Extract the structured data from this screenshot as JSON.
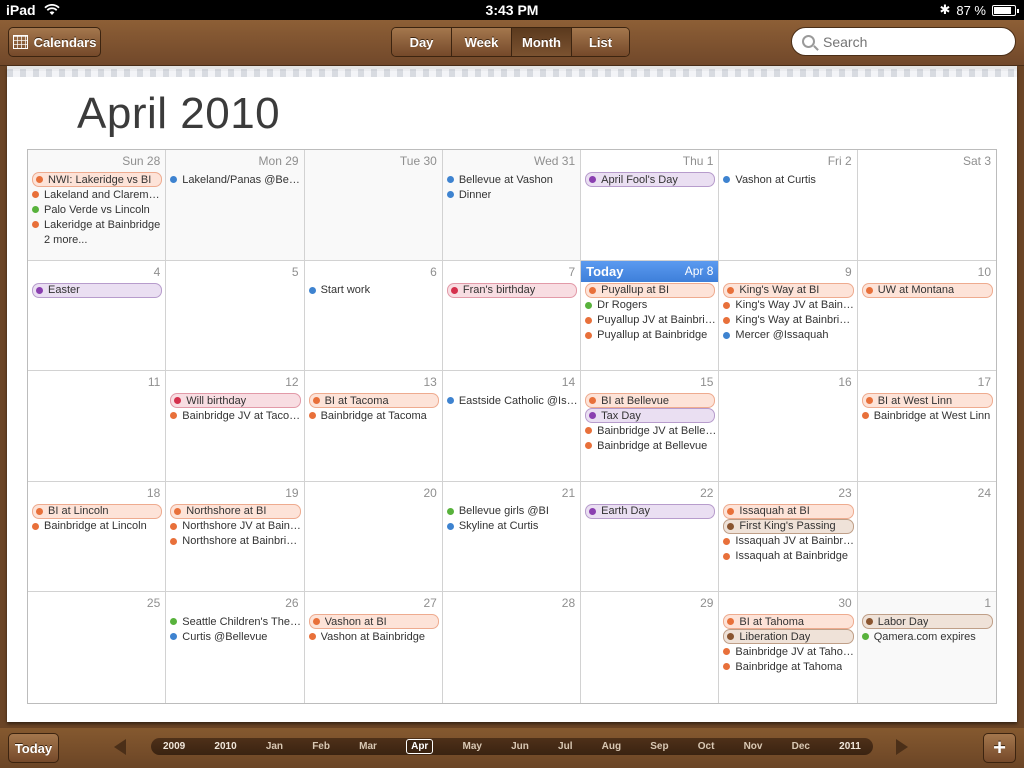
{
  "status": {
    "device": "iPad",
    "time": "3:43 PM",
    "battery": "87 %",
    "battery_fraction": 0.87
  },
  "toolbar": {
    "calendars_label": "Calendars",
    "views": [
      {
        "label": "Day",
        "active": false
      },
      {
        "label": "Week",
        "active": false
      },
      {
        "label": "Month",
        "active": true
      },
      {
        "label": "List",
        "active": false
      }
    ],
    "search_placeholder": "Search"
  },
  "month_title": "April 2010",
  "colors": {
    "orange": "#e8703a",
    "blue": "#3e83d0",
    "green": "#58b23c",
    "red": "#d4304c",
    "purple": "#8a3fb0",
    "brown": "#8a5530"
  },
  "allday_styles": {
    "orange": {
      "bg": "#fde3d8",
      "border": "#eeab8f"
    },
    "purple": {
      "bg": "#eadff2",
      "border": "#b79ccc"
    },
    "red": {
      "bg": "#f8dde2",
      "border": "#e29aa8"
    },
    "brown": {
      "bg": "#efe2d8",
      "border": "#bf9f88"
    }
  },
  "today": {
    "word": "Today",
    "date": "Apr 8"
  },
  "days": [
    {
      "label": "Sun 28",
      "out": true,
      "events": [
        {
          "t": "NWI: Lakeridge vs BI",
          "c": "orange",
          "allday": true
        },
        {
          "t": "Lakeland and Claremont",
          "c": "orange"
        },
        {
          "t": "Palo Verde vs Lincoln",
          "c": "green"
        },
        {
          "t": "Lakeridge at Bainbridge",
          "c": "orange"
        },
        {
          "t": "2 more...",
          "more": true
        }
      ]
    },
    {
      "label": "Mon 29",
      "out": true,
      "events": [
        {
          "t": "Lakeland/Panas @Bellevue",
          "c": "blue"
        }
      ]
    },
    {
      "label": "Tue 30",
      "out": true,
      "events": []
    },
    {
      "label": "Wed 31",
      "out": true,
      "events": [
        {
          "t": "Bellevue at Vashon",
          "c": "blue"
        },
        {
          "t": "Dinner",
          "c": "blue"
        }
      ]
    },
    {
      "label": "Thu 1",
      "events": [
        {
          "t": "April Fool's Day",
          "c": "purple",
          "allday": true
        }
      ]
    },
    {
      "label": "Fri 2",
      "events": [
        {
          "t": "Vashon at Curtis",
          "c": "blue"
        }
      ]
    },
    {
      "label": "Sat 3",
      "events": []
    },
    {
      "label": "4",
      "events": [
        {
          "t": "Easter",
          "c": "purple",
          "allday": true
        }
      ]
    },
    {
      "label": "5",
      "events": []
    },
    {
      "label": "6",
      "events": [
        {
          "t": "Start work",
          "c": "blue"
        }
      ]
    },
    {
      "label": "7",
      "events": [
        {
          "t": "Fran's birthday",
          "c": "red",
          "allday": true
        }
      ]
    },
    {
      "label": "8",
      "today": true,
      "events": [
        {
          "t": "Puyallup at BI",
          "c": "orange",
          "allday": true
        },
        {
          "t": "Dr Rogers",
          "c": "green"
        },
        {
          "t": "Puyallup JV at Bainbridge",
          "c": "orange"
        },
        {
          "t": "Puyallup at Bainbridge",
          "c": "orange"
        }
      ]
    },
    {
      "label": "9",
      "events": [
        {
          "t": "King's Way at BI",
          "c": "orange",
          "allday": true
        },
        {
          "t": "King's Way JV at Bainbridge",
          "c": "orange"
        },
        {
          "t": "King's Way at Bainbridge",
          "c": "orange"
        },
        {
          "t": "Mercer @Issaquah",
          "c": "blue"
        }
      ]
    },
    {
      "label": "10",
      "events": [
        {
          "t": "UW at Montana",
          "c": "orange",
          "allday": true
        }
      ]
    },
    {
      "label": "11",
      "events": []
    },
    {
      "label": "12",
      "events": [
        {
          "t": "Will birthday",
          "c": "red",
          "allday": true
        },
        {
          "t": "Bainbridge JV at Tacoma",
          "c": "orange"
        }
      ]
    },
    {
      "label": "13",
      "events": [
        {
          "t": "BI at Tacoma",
          "c": "orange",
          "allday": true
        },
        {
          "t": "Bainbridge at Tacoma",
          "c": "orange"
        }
      ]
    },
    {
      "label": "14",
      "events": [
        {
          "t": "Eastside Catholic @Issaquah",
          "c": "blue"
        }
      ]
    },
    {
      "label": "15",
      "events": [
        {
          "t": "BI at Bellevue",
          "c": "orange",
          "allday": true
        },
        {
          "t": "Tax Day",
          "c": "purple",
          "allday": true
        },
        {
          "t": "Bainbridge JV at Bellevue",
          "c": "orange"
        },
        {
          "t": "Bainbridge at Bellevue",
          "c": "orange"
        }
      ]
    },
    {
      "label": "16",
      "events": []
    },
    {
      "label": "17",
      "events": [
        {
          "t": "BI at West Linn",
          "c": "orange",
          "allday": true
        },
        {
          "t": "Bainbridge at West Linn",
          "c": "orange"
        }
      ]
    },
    {
      "label": "18",
      "events": [
        {
          "t": "BI at Lincoln",
          "c": "orange",
          "allday": true
        },
        {
          "t": "Bainbridge at Lincoln",
          "c": "orange"
        }
      ]
    },
    {
      "label": "19",
      "events": [
        {
          "t": "Northshore at BI",
          "c": "orange",
          "allday": true
        },
        {
          "t": "Northshore JV at Bainbridge",
          "c": "orange"
        },
        {
          "t": "Northshore at Bainbridge",
          "c": "orange"
        }
      ]
    },
    {
      "label": "20",
      "events": []
    },
    {
      "label": "21",
      "events": [
        {
          "t": "Bellevue girls @BI",
          "c": "green"
        },
        {
          "t": "Skyline at Curtis",
          "c": "blue"
        }
      ]
    },
    {
      "label": "22",
      "events": [
        {
          "t": "Earth Day",
          "c": "purple",
          "allday": true
        }
      ]
    },
    {
      "label": "23",
      "events": [
        {
          "t": "Issaquah at BI",
          "c": "orange",
          "allday": true
        },
        {
          "t": "First King's Passing",
          "c": "brown",
          "allday": true
        },
        {
          "t": "Issaquah JV at Bainbridge",
          "c": "orange"
        },
        {
          "t": "Issaquah at Bainbridge",
          "c": "orange"
        }
      ]
    },
    {
      "label": "24",
      "events": []
    },
    {
      "label": "25",
      "events": []
    },
    {
      "label": "26",
      "events": [
        {
          "t": "Seattle Children's Theatre",
          "c": "green"
        },
        {
          "t": "Curtis @Bellevue",
          "c": "blue"
        }
      ]
    },
    {
      "label": "27",
      "events": [
        {
          "t": "Vashon at BI",
          "c": "orange",
          "allday": true
        },
        {
          "t": "Vashon at Bainbridge",
          "c": "orange"
        }
      ]
    },
    {
      "label": "28",
      "events": []
    },
    {
      "label": "29",
      "events": []
    },
    {
      "label": "30",
      "events": [
        {
          "t": "BI at Tahoma",
          "c": "orange",
          "allday": true
        },
        {
          "t": "Liberation Day",
          "c": "brown",
          "allday": true
        },
        {
          "t": "Bainbridge JV at Tahoma",
          "c": "orange"
        },
        {
          "t": "Bainbridge at Tahoma",
          "c": "orange"
        }
      ]
    },
    {
      "label": "1",
      "out": true,
      "events": [
        {
          "t": "Labor Day",
          "c": "brown",
          "allday": true
        },
        {
          "t": "Qamera.com expires",
          "c": "green"
        }
      ]
    }
  ],
  "bottom": {
    "today_label": "Today",
    "add_label": "+",
    "timeline": [
      {
        "label": "2009",
        "year": true
      },
      {
        "label": "2010",
        "year": true
      },
      {
        "label": "Jan"
      },
      {
        "label": "Feb"
      },
      {
        "label": "Mar"
      },
      {
        "label": "Apr",
        "selected": true
      },
      {
        "label": "May"
      },
      {
        "label": "Jun"
      },
      {
        "label": "Jul"
      },
      {
        "label": "Aug"
      },
      {
        "label": "Sep"
      },
      {
        "label": "Oct"
      },
      {
        "label": "Nov"
      },
      {
        "label": "Dec"
      },
      {
        "label": "2011",
        "year": true
      }
    ]
  }
}
